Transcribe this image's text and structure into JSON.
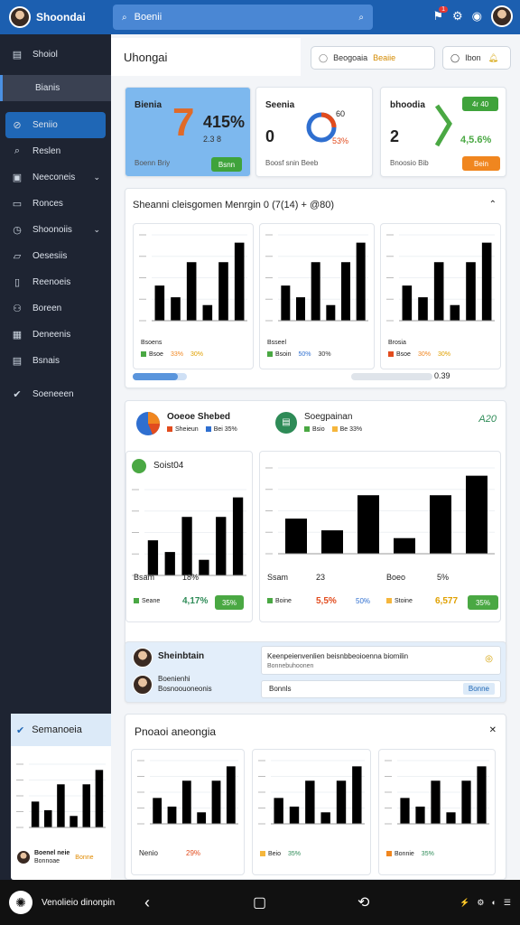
{
  "app": {
    "brand": "Shoondai",
    "search_placeholder": "Boenii"
  },
  "colors": {
    "blue": "#2f6fd0",
    "green": "#4aa843",
    "orange": "#f0861f",
    "red": "#e24c1e",
    "yellow": "#f5b63c"
  },
  "sidebar": {
    "items": [
      {
        "label": "Shoiol",
        "icon": "window-icon"
      },
      {
        "label": "Bianis",
        "icon": "pipe-icon"
      },
      {
        "label": "Seniio",
        "icon": "compass-icon"
      },
      {
        "label": "Reslen",
        "icon": "search-icon"
      },
      {
        "label": "Neeconeis",
        "icon": "doc-icon"
      },
      {
        "label": "Ronces",
        "icon": "chat-icon"
      },
      {
        "label": "Shoonoiis",
        "icon": "clock-icon"
      },
      {
        "label": "Oesesiis",
        "icon": "folder-icon"
      },
      {
        "label": "Reenoeis",
        "icon": "file-icon"
      },
      {
        "label": "Boreen",
        "icon": "people-icon"
      },
      {
        "label": "Deneenis",
        "icon": "calendar-icon"
      },
      {
        "label": "Bsnais",
        "icon": "card-icon"
      },
      {
        "label": "Soeneeen",
        "icon": "check-icon"
      }
    ],
    "widget_title": "Semanoeia"
  },
  "header": {
    "title": "Uhongai",
    "btn1": "Beogoaia",
    "btn1_badge": "Beaiie",
    "btn2": "Ibon"
  },
  "stats": [
    {
      "label": "Bienia",
      "big": "415%",
      "sub": "2.3 8",
      "foot": "Boenn Briy",
      "pill": "Bsnn"
    },
    {
      "label": "Seenia",
      "big": "0",
      "sub": "53%",
      "top": "60",
      "foot": "Boosf snin Beeb"
    },
    {
      "label": "bhoodia",
      "big": "2",
      "sub": "4,5.6%",
      "foot": "Bnoosio Bib",
      "pill": "Bein",
      "pill_top": "4r 40"
    }
  ],
  "panel1": {
    "title": "Sheanni cleisgomen Menrgin 0 (7(14) + @80)",
    "charts": [
      {
        "label": "Bsoens",
        "l1": "Bsoe",
        "v1": "33%",
        "v2": "30%"
      },
      {
        "label": "Bsseel",
        "l1": "Bsoin",
        "v1": "50%",
        "v2": "30%"
      },
      {
        "label": "Brosia",
        "l1": "Bsoe",
        "v1": "30%",
        "v2": "30%"
      }
    ],
    "slider_value": "0.39"
  },
  "panel2": {
    "left_title": "Ooeoe Shebed",
    "left_legend": [
      "Sheieun",
      "Bei 35%"
    ],
    "mid_title": "Soegpainan",
    "mid_legend": [
      "Bsio",
      "Be 33%"
    ],
    "right_value": "A20",
    "card1": {
      "title": "Soist04",
      "a": "Bsam",
      "b": "18%",
      "leg": "Seane",
      "val": "4,17%",
      "pill": "35%"
    },
    "card2": {
      "a": "Ssam",
      "b": "23",
      "c": "Boeo",
      "d": "5%",
      "leg1": "Boine",
      "val1": "5,5%",
      "val2": "50%",
      "leg2": "Stoine",
      "val3": "6,577",
      "pill": "35%"
    }
  },
  "panel3": {
    "name": "Sheinbtain",
    "sub1": "Boenienhi",
    "sub2": "Bosnoouoneonis",
    "notice": "Keenpeienvenlien beisnbbeoioenna biomilin",
    "notice_sub": "Bonnebuhoonen",
    "input": "Bonnls",
    "btn": "Bonne"
  },
  "panel4": {
    "title": "Pnoaoi aneongia",
    "c1": {
      "a": "Nenio",
      "b": "29%"
    },
    "c2": {
      "a": "Beio",
      "b": "35%"
    },
    "c3": {
      "a": "Bonnie",
      "b": "35%"
    }
  },
  "sidewidget": {
    "name": "Boenel neie",
    "sub": "Bonnoae",
    "val": "Bonne"
  },
  "bottom": {
    "label": "Venolieio dinonpin"
  },
  "chart_data": [
    {
      "type": "bar",
      "values": [
        9,
        6,
        15,
        4,
        15,
        20
      ]
    },
    {
      "type": "bar",
      "values": [
        9,
        6,
        15,
        4,
        15,
        20
      ]
    },
    {
      "type": "bar",
      "values": [
        9,
        6,
        15,
        4,
        15,
        20
      ]
    },
    {
      "type": "bar",
      "values": [
        9,
        6,
        15,
        4,
        15,
        20
      ]
    },
    {
      "type": "bar",
      "values": [
        9,
        6,
        15,
        4,
        15,
        20
      ]
    },
    {
      "type": "bar",
      "values": [
        9,
        6,
        15,
        4,
        15,
        20
      ]
    },
    {
      "type": "bar",
      "values": [
        9,
        6,
        15,
        4,
        15,
        20
      ]
    },
    {
      "type": "bar",
      "values": [
        9,
        6,
        15,
        4,
        15,
        20
      ]
    },
    {
      "type": "bar",
      "values": [
        9,
        6,
        15,
        4,
        15,
        20
      ]
    },
    {
      "type": "bar",
      "values": [
        9,
        6,
        15,
        4,
        15,
        20
      ]
    }
  ]
}
